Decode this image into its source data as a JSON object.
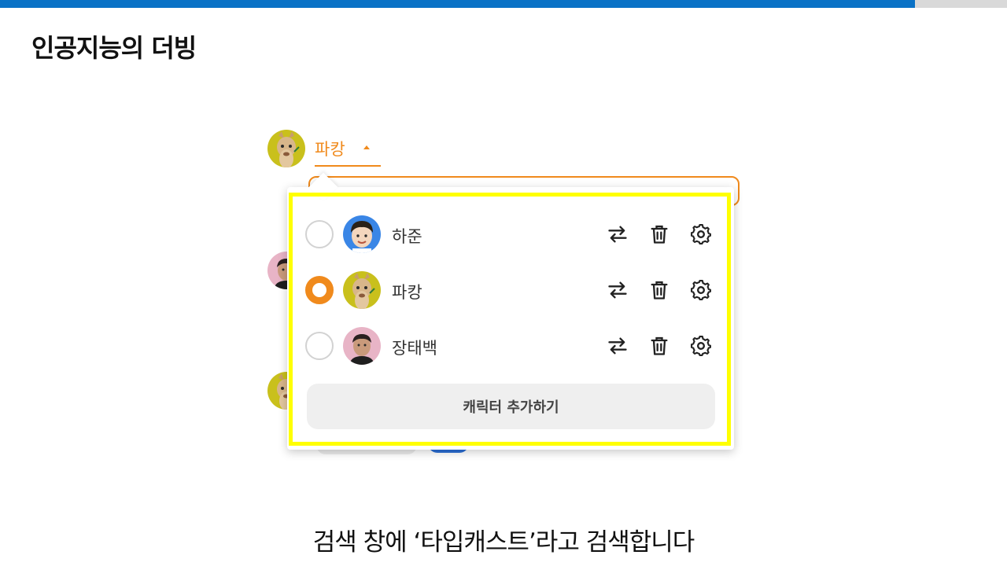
{
  "slide": {
    "title": "인공지능의 더빙",
    "caption": "검색 창에 ‘타입캐스트’라고 검색합니다"
  },
  "colors": {
    "accent": "#f08a1c",
    "top_bar": "#0a72c6",
    "highlight": "#ffff00"
  },
  "header": {
    "selected_character": "파캉",
    "avatar": "llama-avatar",
    "caret": "caret-up-icon"
  },
  "dropdown": {
    "characters": [
      {
        "name": "하준",
        "avatar": "boy-avatar",
        "selected": false
      },
      {
        "name": "파캉",
        "avatar": "llama-avatar",
        "selected": true
      },
      {
        "name": "장태백",
        "avatar": "man-avatar",
        "selected": false
      }
    ],
    "row_icons": [
      "swap-icon",
      "trash-icon",
      "gear-icon"
    ],
    "add_button_label": "캐릭터 추가하기"
  }
}
